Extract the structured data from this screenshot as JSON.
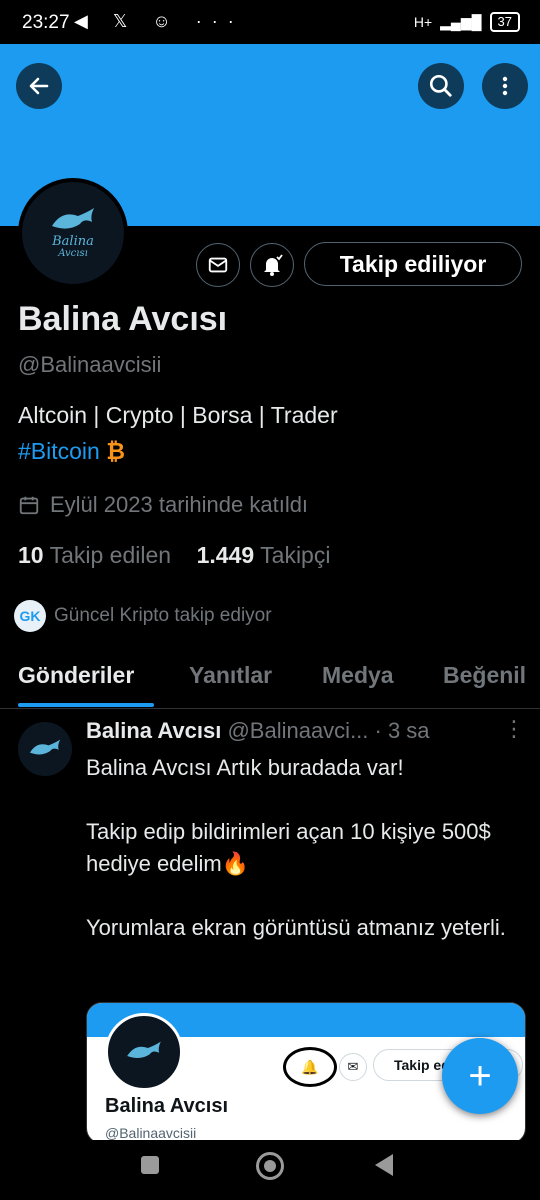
{
  "status_bar": {
    "time": "23:27",
    "icons": "◀ 𝕏 ☺ ···",
    "network": "H+",
    "battery": "37"
  },
  "profile": {
    "name": "Balina Avcısı",
    "handle": "@Balinaavcisii",
    "bio_line1": "Altcoin | Crypto | Borsa | Trader",
    "bio_hashtag": "#Bitcoin",
    "bio_emoji": "₿",
    "joined": "Eylül 2023 tarihinde katıldı",
    "following_count": "10",
    "following_label": "Takip edilen",
    "followers_count": "1.449",
    "followers_label": "Takipçi",
    "followed_by": "Güncel Kripto takip ediyor",
    "followed_by_avatar": "GK",
    "follow_button": "Takip ediliyor",
    "avatar_logo_line1": "Balina",
    "avatar_logo_line2": "Avcısı"
  },
  "tabs": [
    "Gönderiler",
    "Yanıtlar",
    "Medya",
    "Beğenil"
  ],
  "tweet": {
    "author": "Balina Avcısı",
    "handle_time": "@Balinaavci... · 3 sa",
    "text": "Balina Avcısı Artık buradada var!\n\nTakip edip bildirimleri açan 10 kişiye 500$ hediye edelim🔥\n\nYorumlara ekran görüntüsü atmanız yeterli.",
    "media": {
      "name": "Balina Avcısı",
      "handle": "@Balinaavcisii",
      "follow_button": "Takip ed"
    }
  },
  "fab_label": "+",
  "colors": {
    "accent": "#1d9bf0",
    "background": "#000000",
    "muted": "#71767b",
    "bitcoin": "#f7931a"
  }
}
